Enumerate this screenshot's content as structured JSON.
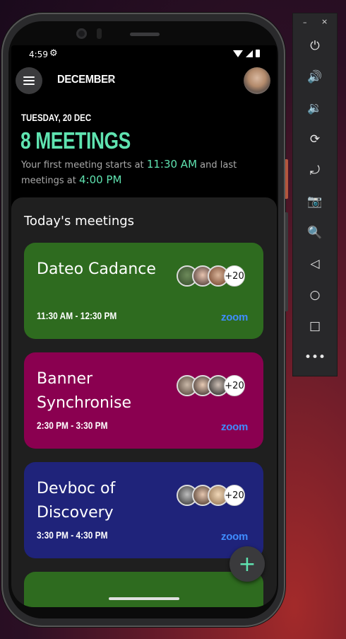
{
  "status": {
    "time": "4:59",
    "gear_icon": "⚙"
  },
  "header": {
    "month": "DECEMBER"
  },
  "day": {
    "date": "TUESDAY, 20 DEC",
    "count": "8 MEETINGS",
    "summary_pre": "Your first meeting starts at",
    "first_time": "11:30 AM",
    "summary_mid": "and last meetings at",
    "last_time": "4:00 PM"
  },
  "panel": {
    "title": "Today's meetings",
    "meetings": [
      {
        "title": "Dateo Cadance",
        "time": "11:30 AM - 12:30 PM",
        "platform": "zoom",
        "more": "+20",
        "color": "#2e6b1f"
      },
      {
        "title": "Banner Synchronise",
        "time": "2:30 PM - 3:30 PM",
        "platform": "zoom",
        "more": "+20",
        "color": "#8a0050"
      },
      {
        "title": "Devboc of Discovery",
        "time": "3:30 PM - 4:30 PM",
        "platform": "zoom",
        "more": "+20",
        "color": "#1f237a"
      }
    ]
  },
  "fab": {
    "label": "+"
  },
  "emulator": {
    "min": "–",
    "close": "×",
    "buttons": [
      "⏻",
      "🔊",
      "🔉",
      "⟳",
      "⤾",
      "📷",
      "🔍",
      "◁",
      "○",
      "□",
      "•••"
    ]
  }
}
